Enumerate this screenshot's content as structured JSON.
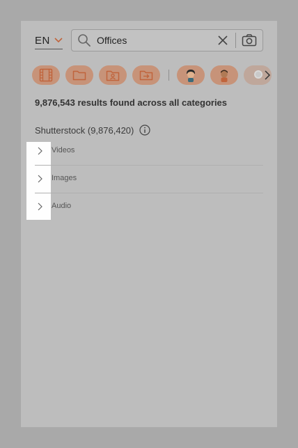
{
  "language": {
    "label": "EN"
  },
  "search": {
    "value": "Offices",
    "placeholder": "Search"
  },
  "filters": [
    {
      "name": "videos-filter",
      "icon": "film-icon"
    },
    {
      "name": "folders-filter",
      "icon": "folder-icon"
    },
    {
      "name": "contacts-filter",
      "icon": "contact-folder-icon"
    },
    {
      "name": "shared-filter",
      "icon": "shared-folder-icon"
    }
  ],
  "results": {
    "summary": "9,876,543 results found across all categories"
  },
  "provider": {
    "label": "Shutterstock (9,876,420)"
  },
  "categories": [
    {
      "label": "Videos"
    },
    {
      "label": "Images"
    },
    {
      "label": "Audio"
    }
  ],
  "colors": {
    "accent": "#c0643c",
    "chip_bg": "#c79379",
    "page_bg": "#a9a9a9",
    "panel_bg": "#bdbdbd"
  }
}
